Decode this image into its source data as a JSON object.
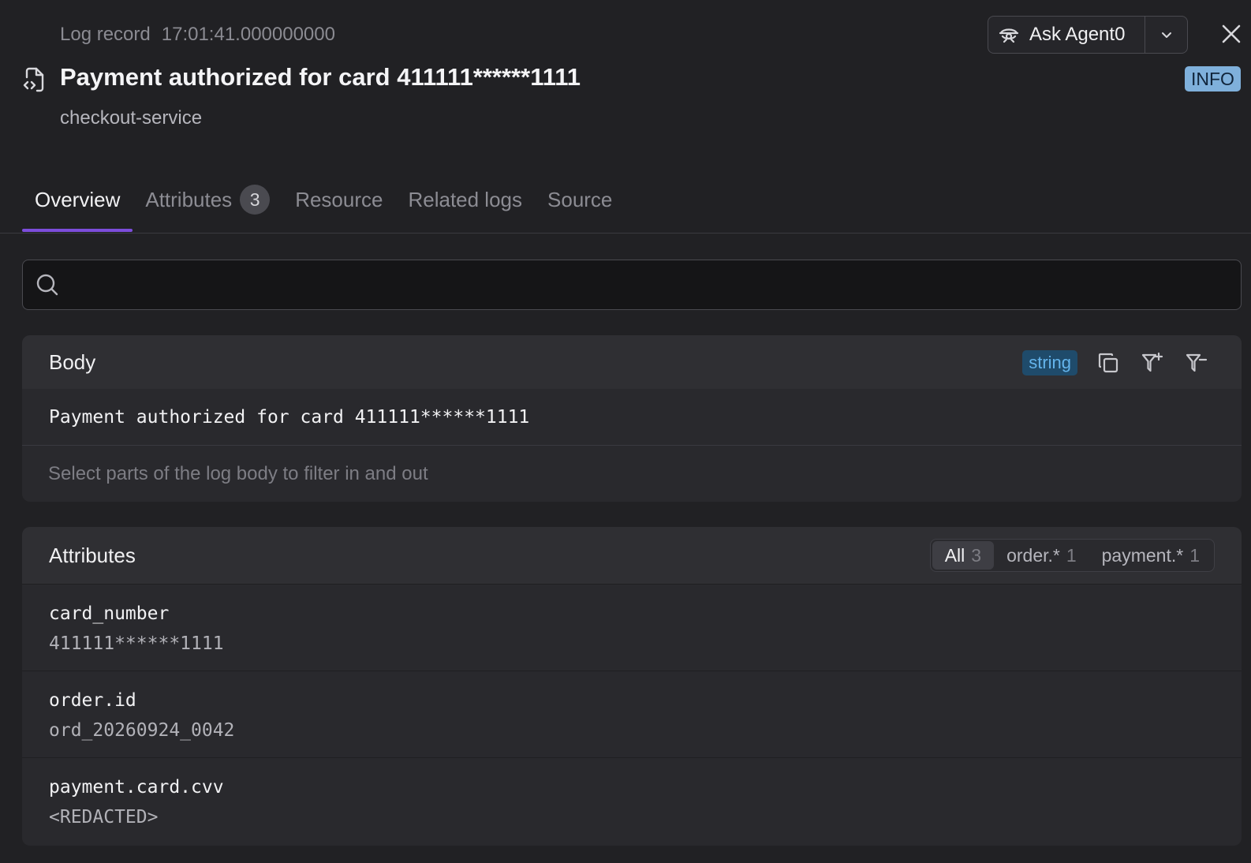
{
  "header": {
    "record_label": "Log record",
    "timestamp": "17:01:41.000000000",
    "title": "Payment authorized for card 411111******1111",
    "service": "checkout-service",
    "severity": "INFO",
    "ask_label": "Ask Agent0"
  },
  "tabs": [
    {
      "label": "Overview"
    },
    {
      "label": "Attributes",
      "count": "3"
    },
    {
      "label": "Resource"
    },
    {
      "label": "Related logs"
    },
    {
      "label": "Source"
    }
  ],
  "search": {
    "placeholder": ""
  },
  "body": {
    "title": "Body",
    "type": "string",
    "text": "Payment authorized for card 411111******1111",
    "hint": "Select parts of the log body to filter in and out"
  },
  "attributes": {
    "title": "Attributes",
    "filters": [
      {
        "label": "All",
        "count": "3"
      },
      {
        "label": "order.*",
        "count": "1"
      },
      {
        "label": "payment.*",
        "count": "1"
      }
    ],
    "rows": [
      {
        "key": "card_number",
        "value": "411111******1111"
      },
      {
        "key": "order.id",
        "value": "ord_20260924_0042"
      },
      {
        "key": "payment.card.cvv",
        "value": "<REDACTED>"
      }
    ]
  },
  "colors": {
    "accent": "#7c4ddb",
    "info_badge": "#7fb0db",
    "type_badge": "#64b4ec"
  },
  "icons": [
    "file-code-icon",
    "agent-icon",
    "chevron-down-icon",
    "close-icon",
    "search-icon",
    "copy-icon",
    "filter-in-icon",
    "filter-out-icon"
  ]
}
